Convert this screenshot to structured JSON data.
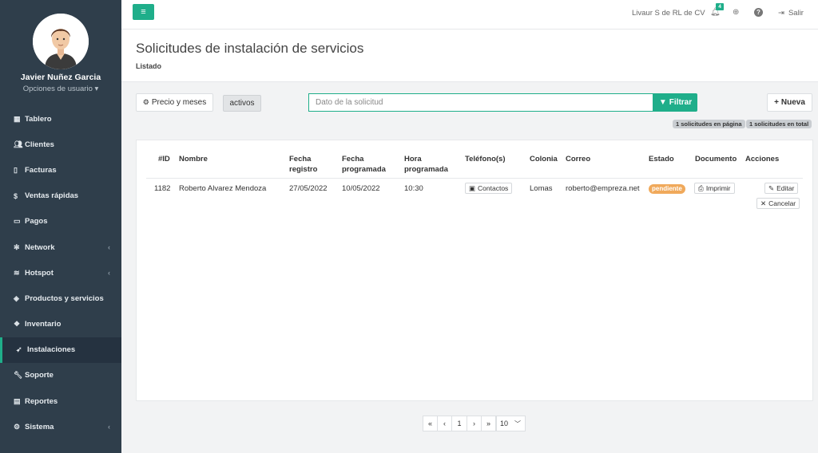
{
  "sidebar": {
    "user_name": "Javier Nuñez Garcia",
    "user_options": "Opciones de usuario ▾",
    "items": [
      {
        "label": "Tablero",
        "icon": "dashboard-icon"
      },
      {
        "label": "Clientes",
        "icon": "users-icon"
      },
      {
        "label": "Facturas",
        "icon": "file-icon"
      },
      {
        "label": "Ventas rápidas",
        "icon": "dollar-icon"
      },
      {
        "label": "Pagos",
        "icon": "money-icon"
      },
      {
        "label": "Network",
        "icon": "network-icon"
      },
      {
        "label": "Hotspot",
        "icon": "wifi-icon"
      },
      {
        "label": "Productos y servicios",
        "icon": "tags-icon"
      },
      {
        "label": "Inventario",
        "icon": "cubes-icon"
      },
      {
        "label": "Instalaciones",
        "icon": "rocket-icon"
      },
      {
        "label": "Soporte",
        "icon": "wrench-icon"
      },
      {
        "label": "Reportes",
        "icon": "book-icon"
      },
      {
        "label": "Sistema",
        "icon": "cogs-icon"
      }
    ]
  },
  "topbar": {
    "company": "Livaur S de RL de CV",
    "notifications": "4",
    "logout": "Salir"
  },
  "header": {
    "title": "Solicitudes de instalación de servicios",
    "subtitle": "Listado"
  },
  "toolbar": {
    "period_button": "Precio y meses",
    "active_toggle": "activos",
    "search_placeholder": "Dato de la solicitud",
    "filter_button": "Filtrar",
    "new_button": "Nueva",
    "count_page": "1 solicitudes en página",
    "count_total": "1 solicitudes en total"
  },
  "table": {
    "headers": {
      "id": "#ID",
      "name": "Nombre",
      "reg1": "Fecha",
      "reg2": "registro",
      "prog1": "Fecha",
      "prog2": "programada",
      "hour1": "Hora",
      "hour2": "programada",
      "phone": "Teléfono(s)",
      "colony": "Colonia",
      "email": "Correo",
      "status": "Estado",
      "doc": "Documento",
      "actions": "Acciones"
    },
    "row": {
      "id": "1182",
      "name": "Roberto Alvarez Mendoza",
      "registered": "27/05/2022",
      "scheduled": "10/05/2022",
      "hour": "10:30",
      "contacts": "Contactos",
      "colony": "Lomas",
      "email": "roberto@empreza.net",
      "status": "pendiente",
      "print": "Imprimir",
      "edit": "Editar",
      "cancel": "Cancelar"
    }
  },
  "pagination": {
    "first": "«",
    "prev": "‹",
    "page": "1",
    "next": "›",
    "last": "»",
    "per_page": "10"
  },
  "colors": {
    "accent": "#1fae8a",
    "sidebar": "#2f3e4b",
    "status_pending": "#f0a95b"
  }
}
